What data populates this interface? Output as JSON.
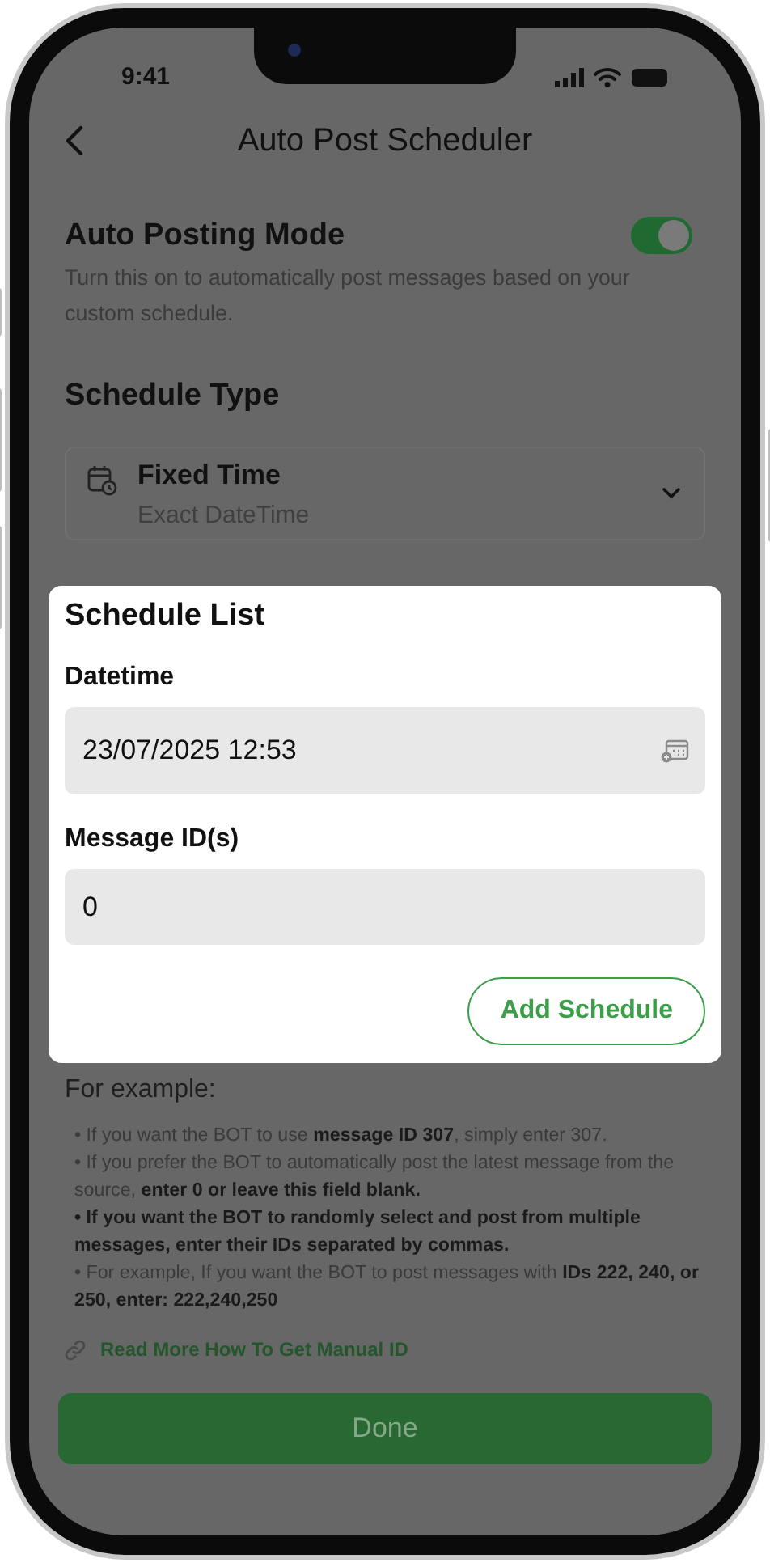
{
  "status_bar": {
    "time": "9:41"
  },
  "header": {
    "title": "Auto Post Scheduler"
  },
  "auto_posting": {
    "title": "Auto Posting Mode",
    "description": "Turn this on to automatically post messages based on your custom schedule.",
    "on": true
  },
  "schedule_type": {
    "heading": "Schedule Type",
    "selection": {
      "title": "Fixed Time",
      "subtitle": "Exact DateTime"
    }
  },
  "schedule_list": {
    "title": "Schedule List",
    "fields": [
      {
        "label": "Datetime",
        "value": "23/07/2025 12:53",
        "kind": "datetime"
      },
      {
        "label": "Message ID(s)",
        "value": "0",
        "kind": "text"
      }
    ],
    "add_button": "Add Schedule"
  },
  "example": {
    "heading": "For example:",
    "bullets": [
      {
        "text": "• If you want the BOT to use **message ID 307**, simply enter 307.",
        "bold": false
      },
      {
        "text": "• If you prefer the BOT to automatically post the latest message from the source, **enter 0 or leave this field blank.**",
        "bold": false
      },
      {
        "text": "• If you want the BOT to randomly select and post from multiple messages, enter their IDs separated by commas.",
        "bold": true
      },
      {
        "text": "• For example, If you want the BOT to post messages with **IDs 222, 240, or 250, enter: 222,240,250**",
        "bold": false
      }
    ]
  },
  "link": {
    "label": "Read More How To Get Manual ID"
  },
  "done_button": "Done"
}
